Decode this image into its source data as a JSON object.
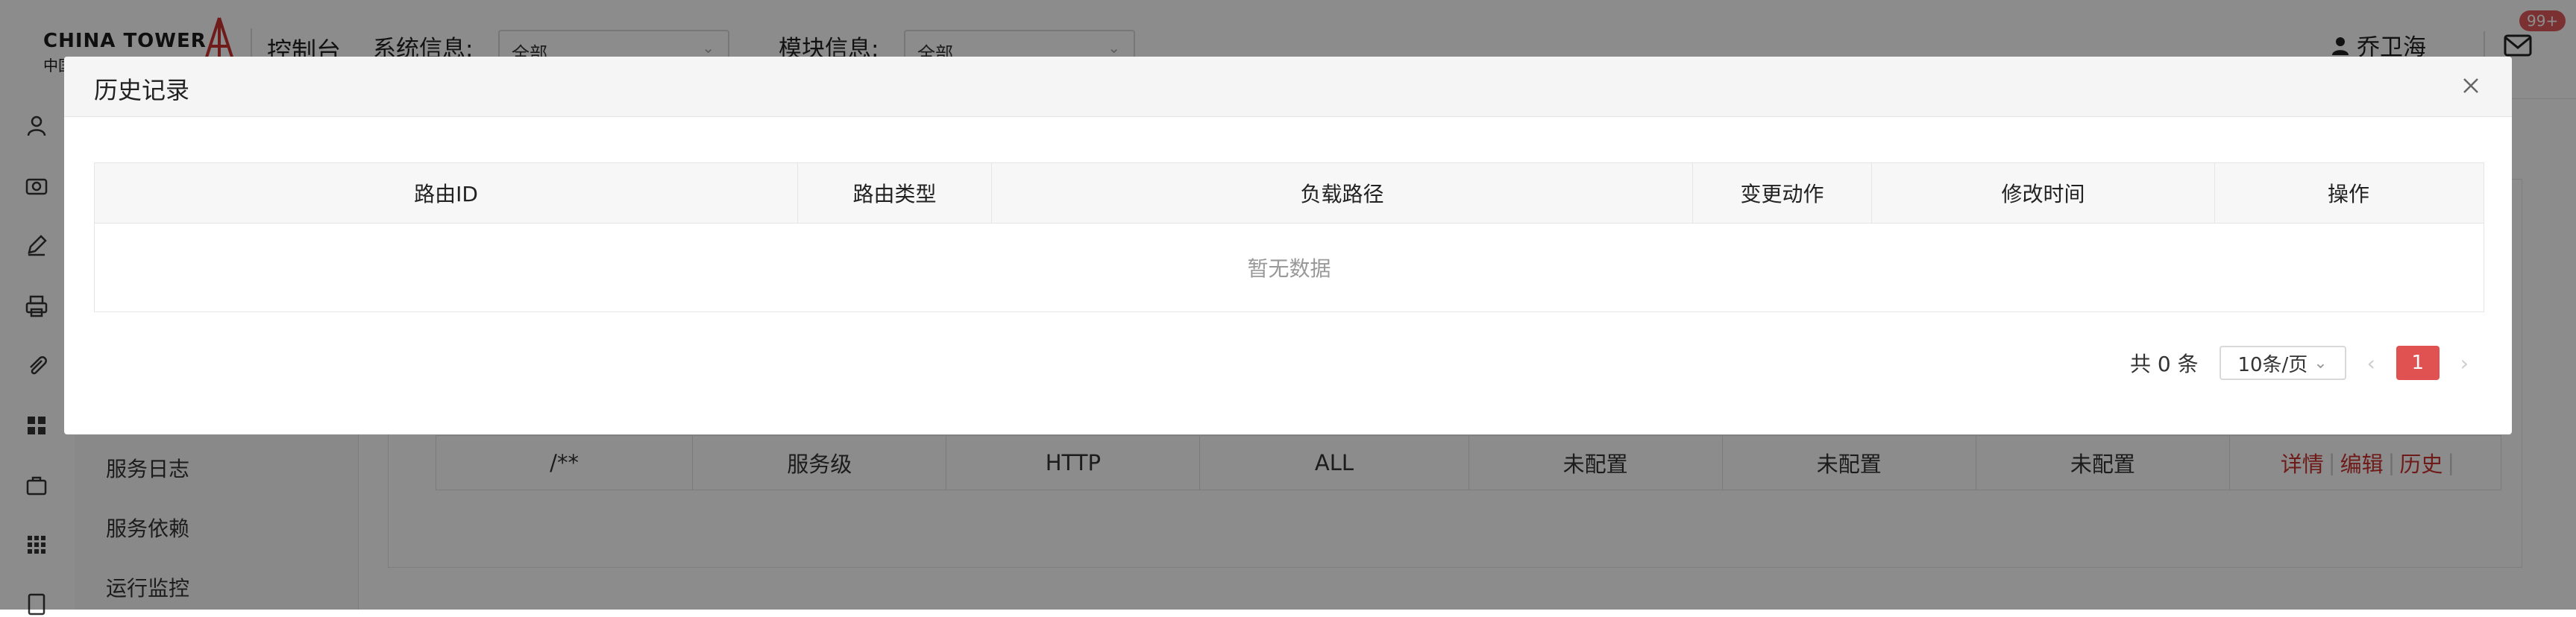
{
  "header": {
    "logo_text": "CHINA TOWER",
    "logo_sub": "中国铁塔",
    "console": "控制台",
    "system_label": "系统信息:",
    "system_value": "全部",
    "module_label": "模块信息:",
    "module_value": "全部",
    "user_name": "乔卫海",
    "badge_count": "99+"
  },
  "side_icons": [
    "user-icon",
    "camera-icon",
    "edit-icon",
    "printer-icon",
    "attachment-icon",
    "grid-icon",
    "bag-icon",
    "apps-icon",
    "doc-icon"
  ],
  "menu": {
    "items": [
      "服务日志",
      "服务依赖",
      "运行监控"
    ]
  },
  "background_table": {
    "row": [
      "/**",
      "服务级",
      "HTTP",
      "ALL",
      "未配置",
      "未配置",
      "未配置"
    ],
    "actions": [
      "详情",
      "编辑",
      "历史"
    ]
  },
  "modal": {
    "title": "历史记录",
    "columns": [
      "路由ID",
      "路由类型",
      "负载路径",
      "变更动作",
      "修改时间",
      "操作"
    ],
    "empty_text": "暂无数据",
    "pagination": {
      "total_text": "共 0 条",
      "page_size": "10条/页",
      "current_page": "1"
    }
  },
  "colors": {
    "accent": "#e05252",
    "action_link": "#c9322f",
    "mask": "rgba(0,0,0,0.45)"
  }
}
